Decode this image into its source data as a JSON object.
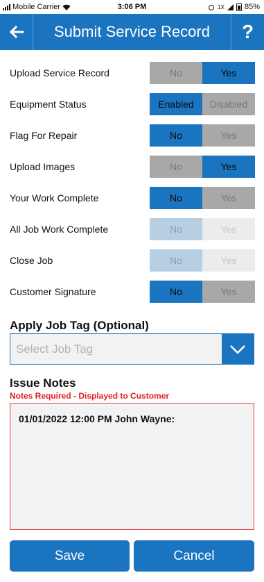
{
  "status_bar": {
    "carrier": "Mobile Carrier",
    "time": "3:06 PM",
    "network": "1X",
    "battery": "85%"
  },
  "header": {
    "title": "Submit Service Record",
    "back_icon": "arrow-left-icon",
    "help_label": "?"
  },
  "toggles": [
    {
      "label": "Upload Service Record",
      "left": "No",
      "right": "Yes",
      "selected": "right",
      "enabled": true
    },
    {
      "label": "Equipment Status",
      "left": "Enabled",
      "right": "Disabled",
      "selected": "left",
      "enabled": true
    },
    {
      "label": "Flag For Repair",
      "left": "No",
      "right": "Yes",
      "selected": "left",
      "enabled": true
    },
    {
      "label": "Upload Images",
      "left": "No",
      "right": "Yes",
      "selected": "right",
      "enabled": true
    },
    {
      "label": "Your Work Complete",
      "left": "No",
      "right": "Yes",
      "selected": "left",
      "enabled": true
    },
    {
      "label": "All Job Work Complete",
      "left": "No",
      "right": "Yes",
      "selected": "left",
      "enabled": false
    },
    {
      "label": "Close Job",
      "left": "No",
      "right": "Yes",
      "selected": "left",
      "enabled": false
    },
    {
      "label": "Customer Signature",
      "left": "No",
      "right": "Yes",
      "selected": "left",
      "enabled": true
    }
  ],
  "job_tag": {
    "title": "Apply Job Tag (Optional)",
    "placeholder": "Select Job Tag"
  },
  "issue_notes": {
    "title": "Issue Notes",
    "required_text": "Notes Required - Displayed to Customer",
    "value": "01/01/2022 12:00 PM John Wayne:"
  },
  "actions": {
    "save_label": "Save",
    "cancel_label": "Cancel"
  },
  "colors": {
    "accent": "#1a74bf",
    "required": "#e01e1e"
  }
}
